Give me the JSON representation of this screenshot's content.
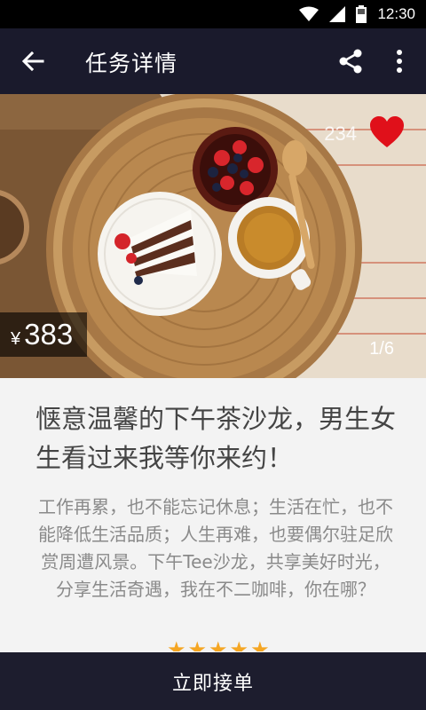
{
  "status_bar": {
    "time": "12:30",
    "icons": [
      "wifi-icon",
      "signal-icon",
      "battery-icon"
    ]
  },
  "app_bar": {
    "title": "任务详情",
    "icons": [
      "back-arrow-icon",
      "share-icon",
      "more-vert-icon"
    ]
  },
  "hero": {
    "like_count": "234",
    "liked": true,
    "price_currency": "¥",
    "price": "383",
    "page_indicator": "1/6",
    "image_subject": "afternoon tea basket with cake, berries, tea cup and spoon"
  },
  "content": {
    "headline": "惬意温馨的下午茶沙龙，男生女生看过来我等你来约！",
    "description": "工作再累，也不能忘记休息；生活在忙，也不能降低生活品质；人生再难，也要偶尔驻足欣赏周遭风景。下午Tee沙龙，共享美好时光，分享生活奇遇，我在不二咖啡，你在哪？",
    "rating_stars": 5
  },
  "bottom_bar": {
    "accept_label": "立即接单"
  },
  "colors": {
    "appbar": "#1a1a2c",
    "heart": "#e0101a",
    "bottom_bar": "#1d1d2e",
    "star": "#f5a623"
  }
}
